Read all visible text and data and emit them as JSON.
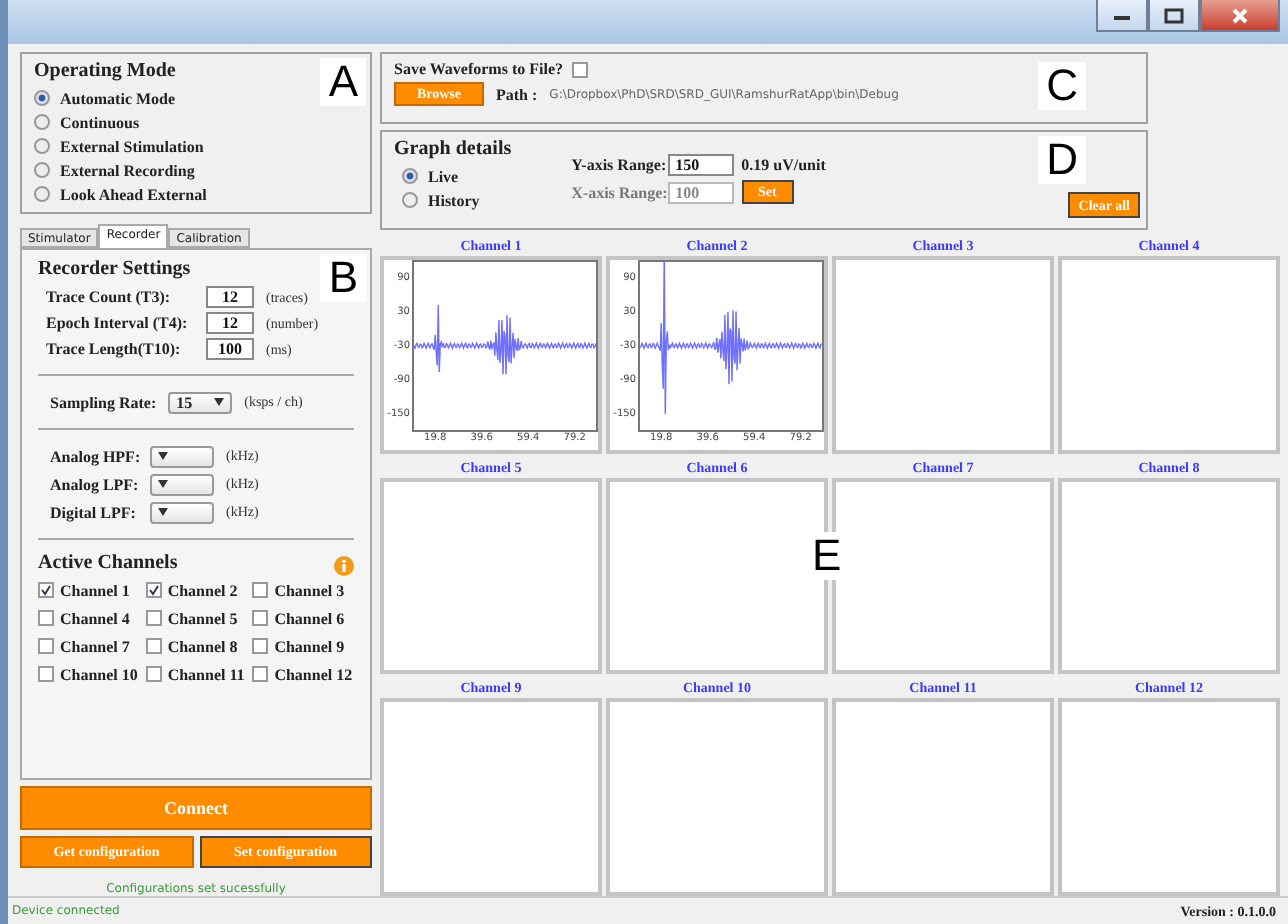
{
  "operating_mode": {
    "title": "Operating Mode",
    "annotation": "A",
    "options": [
      {
        "label": "Automatic Mode",
        "selected": true
      },
      {
        "label": "Continuous",
        "selected": false
      },
      {
        "label": "External Stimulation",
        "selected": false
      },
      {
        "label": "External Recording",
        "selected": false
      },
      {
        "label": "Look Ahead External",
        "selected": false
      }
    ]
  },
  "tabs": [
    {
      "label": "Stimulator",
      "selected": false
    },
    {
      "label": "Recorder",
      "selected": true
    },
    {
      "label": "Calibration",
      "selected": false
    }
  ],
  "recorder_settings": {
    "title": "Recorder Settings",
    "annotation": "B",
    "fields": [
      {
        "label": "Trace Count (T3):",
        "value": "12",
        "unit": "(traces)"
      },
      {
        "label": "Epoch Interval (T4):",
        "value": "12",
        "unit": "(number)"
      },
      {
        "label": "Trace Length(T10):",
        "value": "100",
        "unit": "(ms)"
      }
    ],
    "sampling_rate": {
      "label": "Sampling Rate:",
      "value": "15",
      "unit": "(ksps / ch)"
    },
    "filters": [
      {
        "label": "Analog HPF:",
        "unit": "(kHz)"
      },
      {
        "label": "Analog LPF:",
        "unit": "(kHz)"
      },
      {
        "label": "Digital LPF:",
        "unit": "(kHz)"
      }
    ],
    "active_channels": {
      "title": "Active Channels",
      "items": [
        {
          "label": "Channel 1",
          "checked": true
        },
        {
          "label": "Channel 2",
          "checked": true
        },
        {
          "label": "Channel 3",
          "checked": false
        },
        {
          "label": "Channel 4",
          "checked": false
        },
        {
          "label": "Channel 5",
          "checked": false
        },
        {
          "label": "Channel 6",
          "checked": false
        },
        {
          "label": "Channel 7",
          "checked": false
        },
        {
          "label": "Channel 8",
          "checked": false
        },
        {
          "label": "Channel 9",
          "checked": false
        },
        {
          "label": "Channel 10",
          "checked": false
        },
        {
          "label": "Channel 11",
          "checked": false
        },
        {
          "label": "Channel 12",
          "checked": false
        }
      ]
    }
  },
  "buttons": {
    "connect": "Connect",
    "get_configuration": "Get configuration",
    "set_configuration": "Set configuration"
  },
  "message": "Configurations set sucessfully",
  "save_panel": {
    "label": "Save Waveforms to File?",
    "checked": false,
    "browse": "Browse",
    "path_label": "Path :",
    "path": "G:\\Dropbox\\PhD\\SRD\\SRD_GUI\\RamshurRatApp\\bin\\Debug",
    "annotation": "C"
  },
  "graph_details": {
    "title": "Graph details",
    "annotation": "D",
    "modes": [
      {
        "label": "Live",
        "selected": true
      },
      {
        "label": "History",
        "selected": false
      }
    ],
    "y_range": {
      "label": "Y-axis Range:",
      "value": "150",
      "unit": "0.19 uV/unit"
    },
    "x_range": {
      "label": "X-axis Range:",
      "value": "100",
      "disabled": true
    },
    "set": "Set",
    "clear_all": "Clear all"
  },
  "channels_annotation": "E",
  "channels": [
    {
      "title": "Channel 1",
      "kind": "waveform",
      "y_ticks": [
        "90",
        "30",
        "-30",
        "-90",
        "-150"
      ],
      "x_ticks": [
        "19.8",
        "39.6",
        "59.4",
        "79.2"
      ]
    },
    {
      "title": "Channel 2",
      "kind": "waveform",
      "y_ticks": [
        "90",
        "30",
        "-30",
        "-90",
        "-150"
      ],
      "x_ticks": [
        "19.8",
        "39.6",
        "59.4",
        "79.2"
      ]
    },
    {
      "title": "Channel 3",
      "kind": "empty"
    },
    {
      "title": "Channel 4",
      "kind": "empty"
    },
    {
      "title": "Channel 5",
      "kind": "empty"
    },
    {
      "title": "Channel 6",
      "kind": "empty"
    },
    {
      "title": "Channel 7",
      "kind": "empty"
    },
    {
      "title": "Channel 8",
      "kind": "empty"
    },
    {
      "title": "Channel 9",
      "kind": "empty"
    },
    {
      "title": "Channel 10",
      "kind": "empty"
    },
    {
      "title": "Channel 11",
      "kind": "empty"
    },
    {
      "title": "Channel 12",
      "kind": "empty"
    }
  ],
  "status_bar": {
    "left": "Device connected",
    "right": "Version : 0.1.0.0"
  }
}
